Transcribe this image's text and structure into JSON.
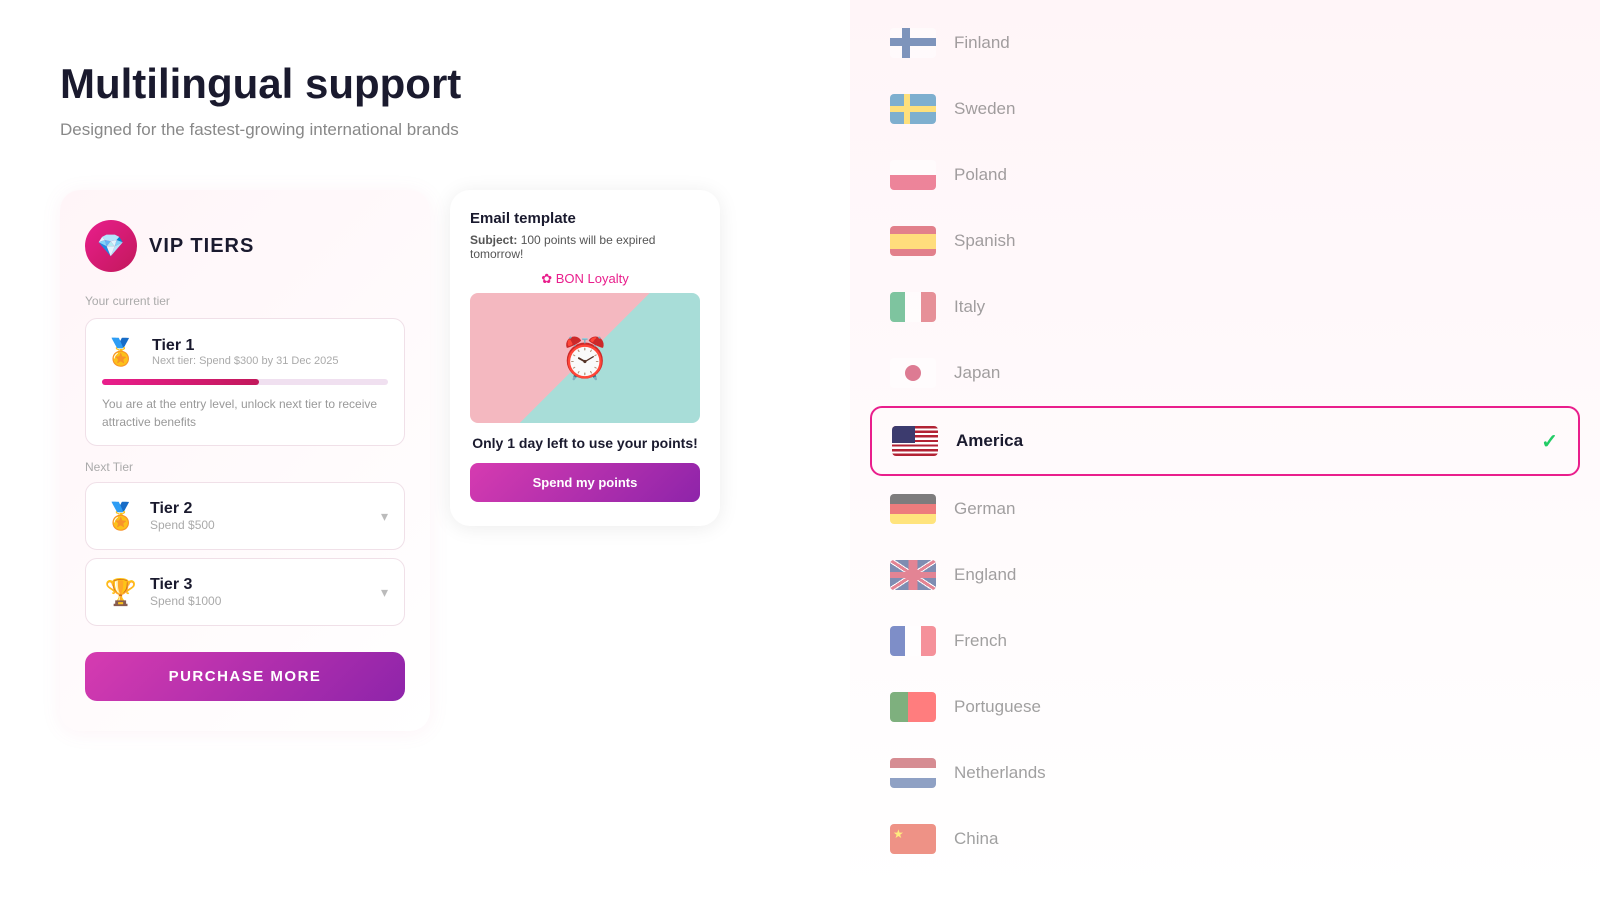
{
  "header": {
    "title": "Multilingual support",
    "subtitle": "Designed for the fastest-growing international brands"
  },
  "vip": {
    "title": "VIP TIERS",
    "current_tier_label": "Your current tier",
    "tier1": {
      "name": "Tier 1",
      "next_info": "Next tier: Spend $300 by 31 Dec 2025",
      "description": "You are at the entry level, unlock next tier to receive attractive benefits"
    },
    "next_tier_label": "Next Tier",
    "tier2": {
      "name": "Tier 2",
      "spend": "Spend $500"
    },
    "tier3": {
      "name": "Tier 3",
      "spend": "Spend $1000"
    },
    "purchase_btn": "PURCHASE MORE"
  },
  "email": {
    "title": "Email template",
    "subject_label": "Subject:",
    "subject_text": "100 points will be expired tomorrow!",
    "brand": "BON Loyalty",
    "cta": "Only 1 day left to use your points!",
    "btn": "Spend my points"
  },
  "languages": [
    {
      "id": "finland",
      "name": "Finland",
      "selected": false
    },
    {
      "id": "sweden",
      "name": "Sweden",
      "selected": false
    },
    {
      "id": "poland",
      "name": "Poland",
      "selected": false
    },
    {
      "id": "spanish",
      "name": "Spanish",
      "selected": false
    },
    {
      "id": "italy",
      "name": "Italy",
      "selected": false
    },
    {
      "id": "japan",
      "name": "Japan",
      "selected": false
    },
    {
      "id": "america",
      "name": "America",
      "selected": true
    },
    {
      "id": "german",
      "name": "German",
      "selected": false
    },
    {
      "id": "england",
      "name": "England",
      "selected": false
    },
    {
      "id": "french",
      "name": "French",
      "selected": false
    },
    {
      "id": "portuguese",
      "name": "Portuguese",
      "selected": false
    },
    {
      "id": "netherlands",
      "name": "Netherlands",
      "selected": false
    },
    {
      "id": "china",
      "name": "China",
      "selected": false
    }
  ]
}
